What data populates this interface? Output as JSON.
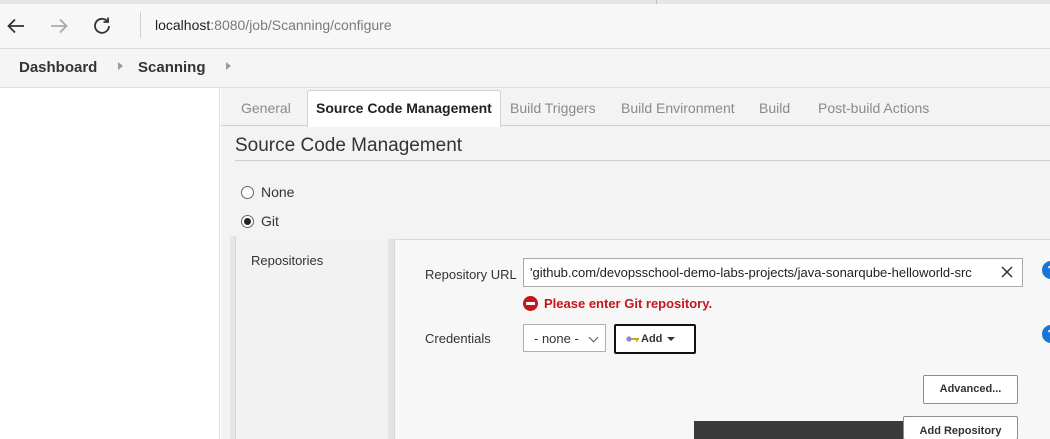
{
  "browser": {
    "url_host": "localhost",
    "url_path": ":8080/job/Scanning/configure"
  },
  "breadcrumb": {
    "items": [
      "Dashboard",
      "Scanning"
    ]
  },
  "tabs": [
    "General",
    "Source Code Management",
    "Build Triggers",
    "Build Environment",
    "Build",
    "Post-build Actions"
  ],
  "active_tab": "Source Code Management",
  "section": {
    "title": "Source Code Management"
  },
  "scm_options": [
    {
      "label": "None",
      "selected": false
    },
    {
      "label": "Git",
      "selected": true
    }
  ],
  "repositories": {
    "label": "Repositories",
    "url_label": "Repository URL",
    "url_value": "'github.com/devopsschool-demo-labs-projects/java-sonarqube-helloworld-src",
    "error": "Please enter Git repository.",
    "credentials_label": "Credentials",
    "credentials_value": "- none -",
    "add_label": "Add",
    "advanced_label": "Advanced...",
    "add_repository_label": "Add Repository"
  },
  "colors": {
    "error": "#c4161c",
    "help": "#1976d2"
  }
}
